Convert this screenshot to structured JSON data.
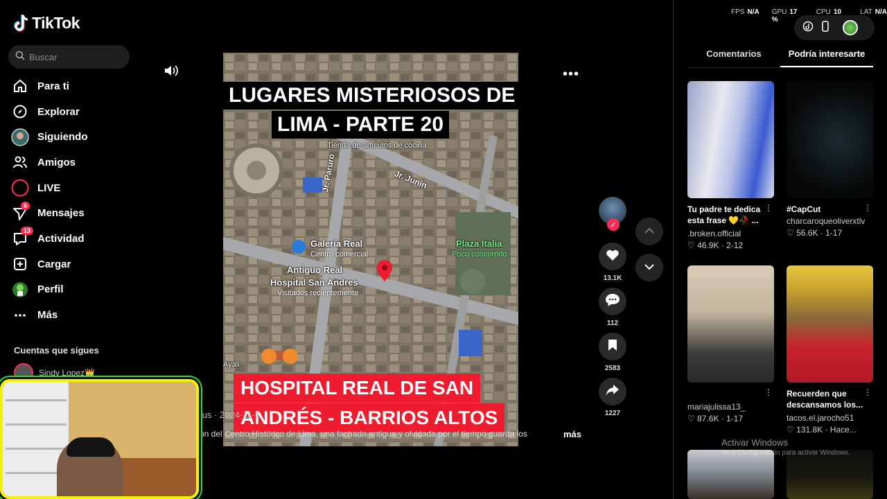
{
  "brand": {
    "name": "TikTok"
  },
  "search": {
    "placeholder": "Buscar"
  },
  "nav": [
    {
      "label": "Para ti",
      "icon": "home-icon",
      "badge": ""
    },
    {
      "label": "Explorar",
      "icon": "compass-icon",
      "badge": ""
    },
    {
      "label": "Siguiendo",
      "icon": "following-avatar-icon",
      "badge": ""
    },
    {
      "label": "Amigos",
      "icon": "friends-icon",
      "badge": ""
    },
    {
      "label": "LIVE",
      "icon": "live-icon",
      "badge": ""
    },
    {
      "label": "Mensajes",
      "icon": "message-icon",
      "badge": "6"
    },
    {
      "label": "Actividad",
      "icon": "activity-icon",
      "badge": "13"
    },
    {
      "label": "Cargar",
      "icon": "upload-icon",
      "badge": ""
    },
    {
      "label": "Perfil",
      "icon": "profile-avatar-icon",
      "badge": ""
    },
    {
      "label": "Más",
      "icon": "more-icon",
      "badge": ""
    }
  ],
  "following": {
    "title": "Cuentas que sigues",
    "first_account": "Sindy Lopez👑"
  },
  "video": {
    "title_line1": "LUGARES MISTERIOSOS DE",
    "title_line2": "LIMA - PARTE 20",
    "bottom_line1": "HOSPITAL REAL DE SAN",
    "bottom_line2": "ANDRÉS - BARRIOS ALTOS",
    "map_labels": {
      "shop": "Tienda de artículos de cocina",
      "street1": "Jr. Junín",
      "street2": "Jr. Paruro",
      "galeria": "Galería Real",
      "galeria_sub": "Centro comercial",
      "hospital": "Antiguo Real",
      "hospital2": "Hospital San Andres",
      "hospital_sub": "Visitados recientemente",
      "plaza": "Plaza Italia",
      "plaza_sub": "Poco concurrido",
      "street3": "Ayali"
    },
    "author_line": ".us · 2024-11-1",
    "caption": "ón del Centro Histórico de Lima, una fachada antigua y olvidada por el tiempo guarda los",
    "more_label": "más"
  },
  "actions": {
    "likes": "13.1K",
    "comments": "112",
    "saves": "2583",
    "shares": "1227"
  },
  "perf": {
    "fps_label": "FPS",
    "fps": "N/A",
    "gpu_label": "GPU",
    "gpu": "17 %",
    "cpu_label": "CPU",
    "cpu": "10 %",
    "lat_label": "LAT",
    "lat": "N/A"
  },
  "panel": {
    "tab_comments": "Comentarios",
    "tab_suggested": "Podría interesarte",
    "cards": [
      {
        "title": "Tu padre te dedica esta frase 💛🥀 ...",
        "user": ".broken.official",
        "stats": "46.9K · 2-12"
      },
      {
        "title": "#CapCut",
        "user": "charcaroqueoliverxtlv",
        "stats": "56.6K · 1-17"
      },
      {
        "title": "",
        "user": "mariajulissa13_",
        "stats": "87.6K · 1-17"
      },
      {
        "title": "Recuerden que descansamos los...",
        "user": "tacos.el.jarocho51",
        "stats": "131.8K · Hace..."
      }
    ]
  },
  "windows": {
    "activate": "Activar Windows",
    "activate_sub": "Ve a Configuración para activar Windows."
  },
  "colors": {
    "accent": "#fe2c55",
    "map_pin": "#ee1c2e",
    "panel_bg": "#000000"
  }
}
